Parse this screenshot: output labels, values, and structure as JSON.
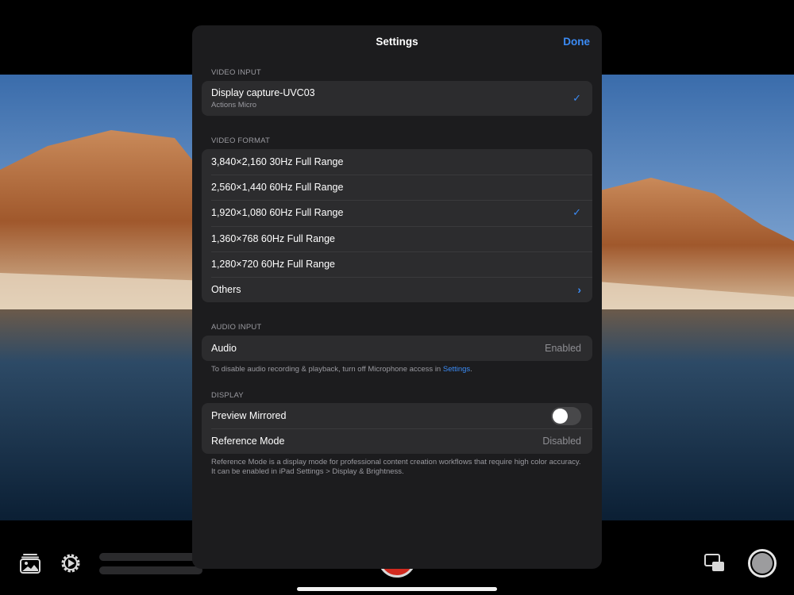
{
  "sheet": {
    "title": "Settings",
    "done_label": "Done"
  },
  "video_input": {
    "header": "VIDEO INPUT",
    "device_name": "Display capture-UVC03",
    "device_vendor": "Actions Micro",
    "selected": true
  },
  "video_format": {
    "header": "VIDEO FORMAT",
    "items": [
      {
        "label": "3,840×2,160 30Hz Full Range",
        "selected": false
      },
      {
        "label": "2,560×1,440 60Hz Full Range",
        "selected": false
      },
      {
        "label": "1,920×1,080 60Hz Full Range",
        "selected": true
      },
      {
        "label": "1,360×768 60Hz Full Range",
        "selected": false
      },
      {
        "label": "1,280×720 60Hz Full Range",
        "selected": false
      }
    ],
    "others_label": "Others"
  },
  "audio_input": {
    "header": "AUDIO INPUT",
    "label": "Audio",
    "value": "Enabled",
    "note_prefix": "To disable audio recording & playback, turn off Microphone access in ",
    "note_link": "Settings",
    "note_suffix": "."
  },
  "display": {
    "header": "DISPLAY",
    "preview_mirrored_label": "Preview Mirrored",
    "preview_mirrored_on": false,
    "reference_mode_label": "Reference Mode",
    "reference_mode_value": "Disabled",
    "note": "Reference Mode is a display mode for professional content creation workflows that require high color accuracy. It can be enabled in iPad Settings > Display & Brightness."
  },
  "icons": {
    "check": "checkmark-icon",
    "chevron": "chevron-right-icon",
    "gallery": "photo-library-icon",
    "gear": "settings-gear-icon",
    "pip": "picture-in-picture-icon",
    "shutter": "shutter-button"
  },
  "colors": {
    "accent": "#3b8bf5",
    "sheet_bg": "#1c1c1e",
    "group_bg": "#2c2c2e"
  }
}
